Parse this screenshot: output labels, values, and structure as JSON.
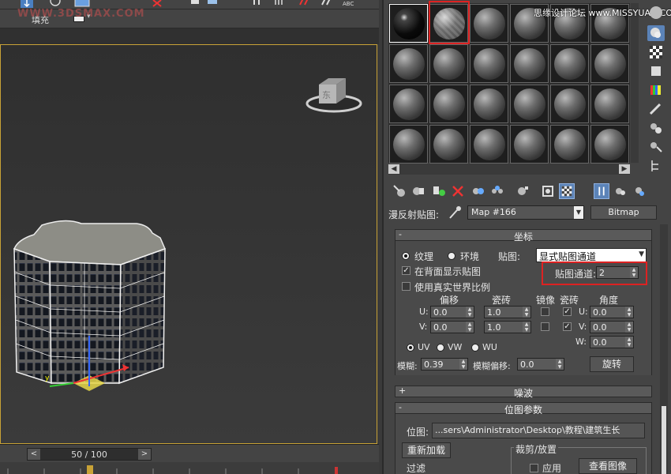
{
  "viewport": {
    "ribbon_fill_label": "填充",
    "watermark": "WWW.3DSMAX.COM",
    "viewcube_label": "东"
  },
  "timeline": {
    "frame_readout": "50 / 100",
    "prev_label": "<",
    "next_label": ">"
  },
  "material_editor": {
    "brand_watermark": "思缘设计论坛 www.MISSYUAN.COM",
    "map_label": "漫反射贴图:",
    "map_name": "Map #166",
    "map_type_button": "Bitmap",
    "coordinates": {
      "title": "坐标",
      "collapse_sign": "-",
      "texture_label": "纹理",
      "environ_label": "环境",
      "mapping_label": "贴图:",
      "mapping_value": "显式贴图通道",
      "show_map_on_back": "在背面显示贴图",
      "use_real_world": "使用真实世界比例",
      "map_channel_label": "贴图通道:",
      "map_channel_value": "2",
      "offset_label": "偏移",
      "tiling_label": "瓷砖",
      "mirror_label": "镜像",
      "tile_label": "瓷砖",
      "angle_label": "角度",
      "u_label": "U:",
      "v_label": "V:",
      "w_label": "W:",
      "u_offset": "0.0",
      "v_offset": "0.0",
      "u_tiling": "1.0",
      "v_tiling": "1.0",
      "u_angle": "0.0",
      "v_angle": "0.0",
      "w_angle": "0.0",
      "uv_label": "UV",
      "vw_label": "VW",
      "wu_label": "WU",
      "blur_label": "模糊:",
      "blur_value": "0.39",
      "blur_offset_label": "模糊偏移:",
      "blur_offset_value": "0.0",
      "rotate_button": "旋转"
    },
    "noise": {
      "title": "噪波",
      "collapse_sign": "+"
    },
    "bitmap_params": {
      "title": "位图参数",
      "collapse_sign": "-",
      "bitmap_label": "位图:",
      "bitmap_path": "...sers\\Administrator\\Desktop\\教程\\建筑生长\\02.png",
      "reload_button": "重新加载",
      "crop_place_label": "裁剪/放置",
      "apply_label": "应用",
      "view_image_button": "查看图像",
      "filter_label": "过滤"
    }
  },
  "colors": {
    "highlight_red": "#d22222",
    "viewport_border": "#c8a236",
    "pressed_blue": "#5b83b8"
  }
}
